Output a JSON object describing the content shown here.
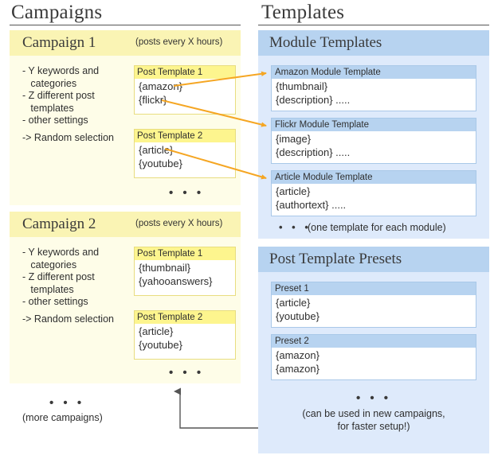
{
  "columns": {
    "left_title": "Campaigns",
    "right_title": "Templates"
  },
  "campaigns": [
    {
      "name": "Campaign 1",
      "rate": "(posts every X hours)",
      "bullets": [
        "- Y keywords and\n   categories",
        "- Z different post\n   templates",
        "- other settings"
      ],
      "random": "-> Random selection",
      "post_templates": [
        {
          "title": "Post Template 1",
          "lines": [
            "{amazon}",
            "{flickr}"
          ]
        },
        {
          "title": "Post Template 2",
          "lines": [
            "{article}",
            "{youtube}"
          ]
        }
      ],
      "more_dots": "• • •"
    },
    {
      "name": "Campaign 2",
      "rate": "(posts every X hours)",
      "bullets": [
        "- Y keywords and\n   categories",
        "- Z different post\n   templates",
        "- other settings"
      ],
      "random": "-> Random selection",
      "post_templates": [
        {
          "title": "Post Template 1",
          "lines": [
            "{thumbnail}",
            "{yahooanswers}"
          ]
        },
        {
          "title": "Post Template 2",
          "lines": [
            "{article}",
            "{youtube}"
          ]
        }
      ],
      "more_dots": "• • •"
    }
  ],
  "more_campaigns": {
    "dots": "• • •",
    "label": "(more campaigns)"
  },
  "templates": {
    "module_section": {
      "title": "Module Templates",
      "boxes": [
        {
          "title": "Amazon Module Template",
          "lines": [
            "{thumbnail}",
            "{description} ....."
          ]
        },
        {
          "title": "Flickr Module Template",
          "lines": [
            "{image}",
            "{description} ....."
          ]
        },
        {
          "title": "Article Module Template",
          "lines": [
            "{article}",
            "{authortext} ....."
          ]
        }
      ],
      "footer_dots": "• • •",
      "footer_note": "(one template for each module)"
    },
    "preset_section": {
      "title": "Post Template Presets",
      "boxes": [
        {
          "title": "Preset 1",
          "lines": [
            "{article}",
            "{youtube}"
          ]
        },
        {
          "title": "Preset 2",
          "lines": [
            "{amazon}",
            "{amazon}"
          ]
        }
      ],
      "footer_dots": "• • •",
      "footer_note_line1": "(can be used in new campaigns,",
      "footer_note_line2": "for faster setup!)"
    }
  },
  "colors": {
    "campaign_header": "#faf4b4",
    "campaign_body": "#fefde8",
    "post_template_header": "#fdf58e",
    "templates_header": "#b7d3f0",
    "templates_body": "#deeafb",
    "arrow_orange": "#f5a623",
    "connector_gray": "#555555"
  }
}
